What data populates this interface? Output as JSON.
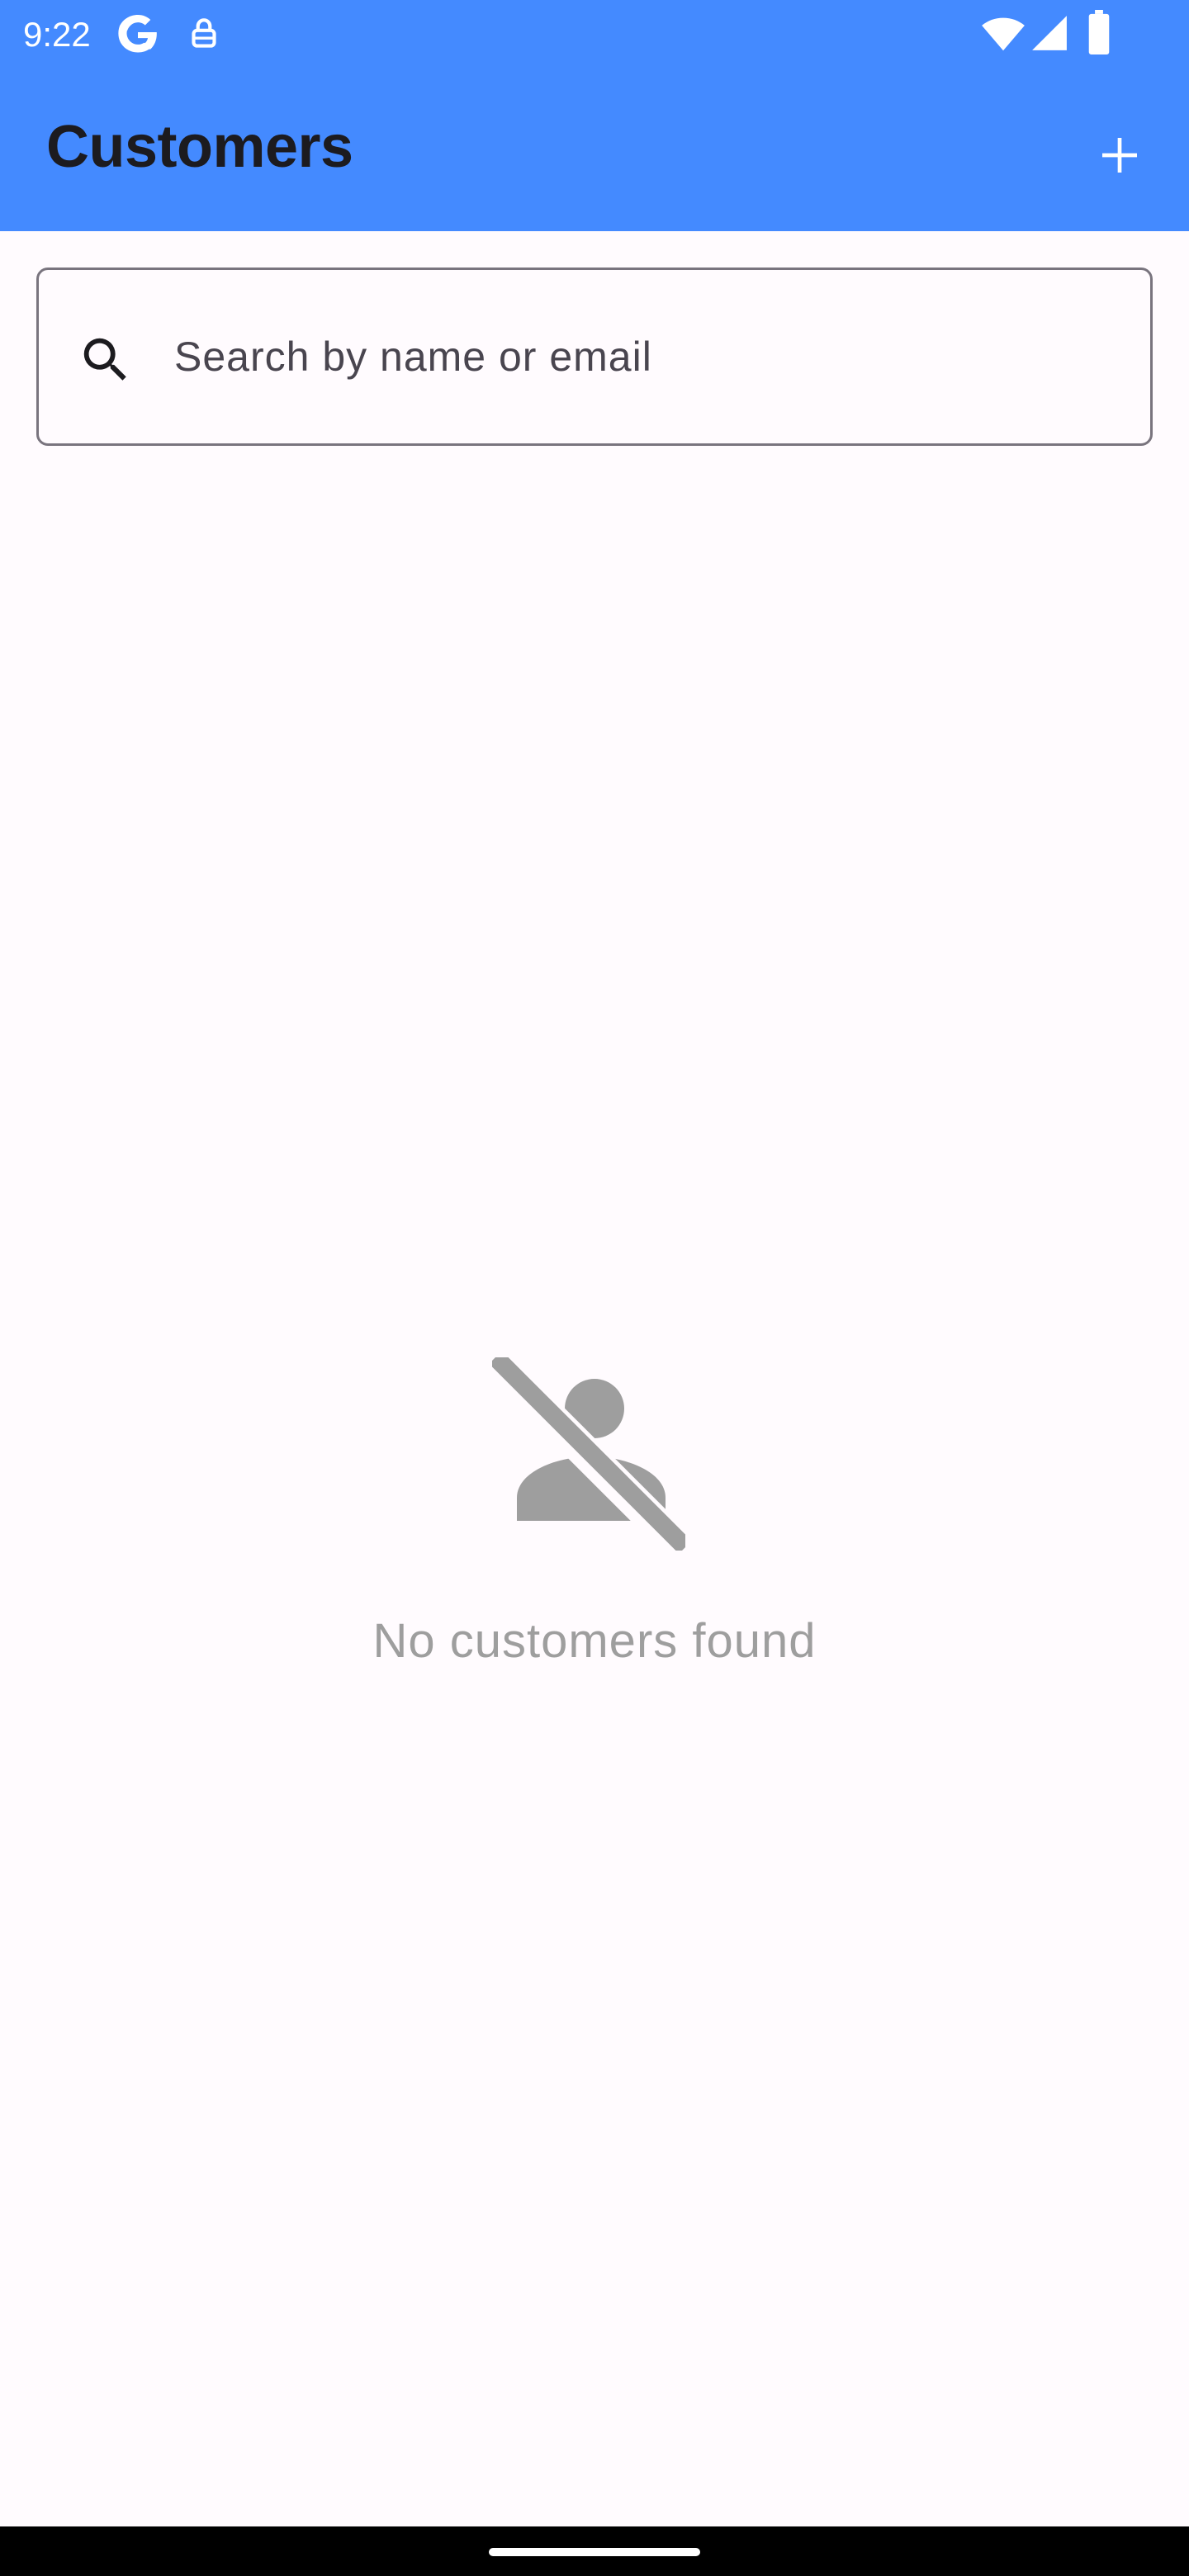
{
  "status_bar": {
    "time": "9:22",
    "icons": [
      "google-g-icon",
      "vpn-key-icon",
      "wifi-icon",
      "cellular-signal-icon",
      "battery-icon"
    ]
  },
  "app_bar": {
    "title": "Customers",
    "add_action_icon": "plus-icon",
    "background_color": "#448aff"
  },
  "search": {
    "placeholder": "Search by name or email",
    "value": "",
    "icon": "search-icon"
  },
  "empty_state": {
    "icon": "person-off-icon",
    "message": "No customers found"
  },
  "navigation_bar": {
    "handle": "gesture-handle"
  }
}
